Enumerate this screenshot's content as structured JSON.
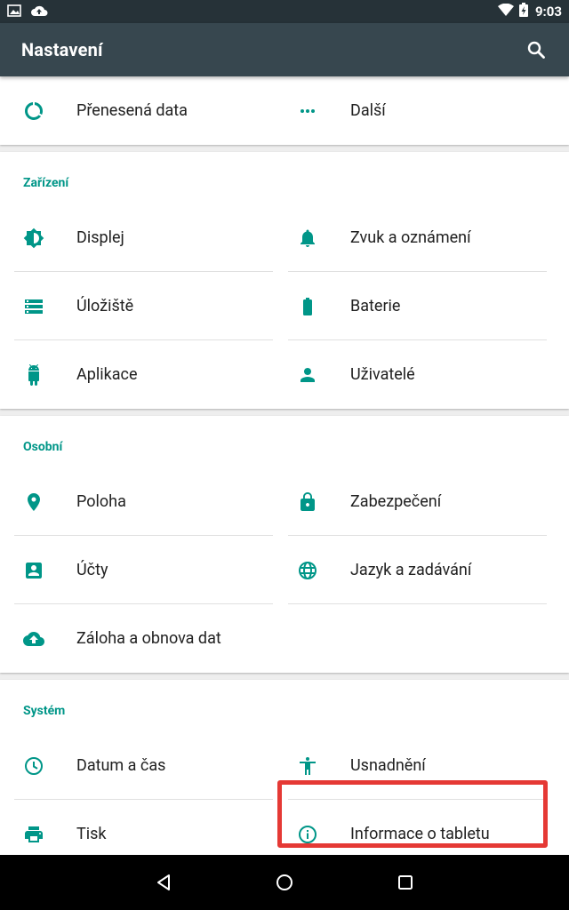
{
  "status": {
    "time": "9:03"
  },
  "toolbar": {
    "title": "Nastavení"
  },
  "top_items": [
    {
      "label": "Přenesená data",
      "icon": "data-usage-icon"
    },
    {
      "label": "Další",
      "icon": "more-horiz-icon"
    }
  ],
  "sections": [
    {
      "title": "Zařízení",
      "items": [
        {
          "label": "Displej",
          "icon": "brightness-icon"
        },
        {
          "label": "Zvuk a oznámení",
          "icon": "bell-icon"
        },
        {
          "label": "Úložiště",
          "icon": "storage-icon"
        },
        {
          "label": "Baterie",
          "icon": "battery-icon"
        },
        {
          "label": "Aplikace",
          "icon": "android-icon"
        },
        {
          "label": "Uživatelé",
          "icon": "person-icon"
        }
      ]
    },
    {
      "title": "Osobní",
      "items": [
        {
          "label": "Poloha",
          "icon": "location-pin-icon"
        },
        {
          "label": "Zabezpečení",
          "icon": "lock-icon"
        },
        {
          "label": "Účty",
          "icon": "account-box-icon"
        },
        {
          "label": "Jazyk a zadávání",
          "icon": "globe-icon"
        },
        {
          "label": "Záloha a obnova dat",
          "icon": "cloud-upload-icon"
        }
      ]
    },
    {
      "title": "Systém",
      "items": [
        {
          "label": "Datum a čas",
          "icon": "clock-icon"
        },
        {
          "label": "Usnadnění",
          "icon": "accessibility-icon"
        },
        {
          "label": "Tisk",
          "icon": "printer-icon"
        },
        {
          "label": "Informace o tabletu",
          "icon": "info-icon"
        }
      ]
    }
  ],
  "colors": {
    "accent": "#009688",
    "toolbar": "#37474f",
    "statusbar": "#263238",
    "highlight": "#e53935"
  }
}
